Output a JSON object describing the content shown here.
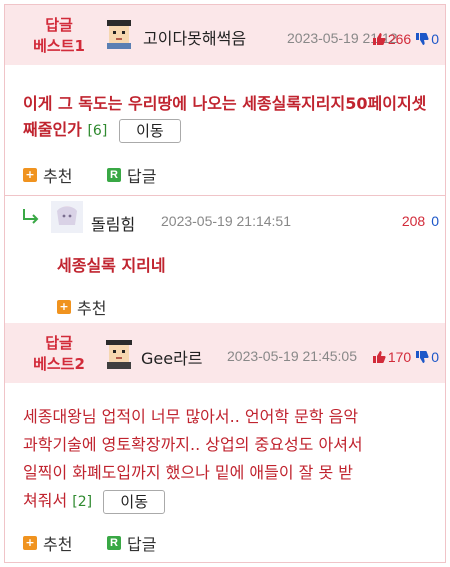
{
  "best1": {
    "tag": "답글\n베스트1",
    "tag_line1": "답글",
    "tag_line2": "베스트1",
    "nickname": "고이다못해썩음",
    "datetime": "2023-05-19 21:12",
    "upvotes": "266",
    "downvotes": "0",
    "content": "이게 그 독도는 우리땅에 나오는 세종실록지리지50페이지셋째줄인가",
    "reply_count": "[6]",
    "move_label": "이동",
    "recommend_label": "추천",
    "reply_label": "답글"
  },
  "nested_reply": {
    "nickname": "돌림힘",
    "datetime": "2023-05-19 21:14:51",
    "upvotes": "208",
    "downvotes": "0",
    "content": "세종실록 지리네",
    "recommend_label": "추천"
  },
  "best2": {
    "tag_line1": "답글",
    "tag_line2": "베스트2",
    "nickname": "Gee라르",
    "datetime": "2023-05-19 21:45:05",
    "upvotes": "170",
    "downvotes": "0",
    "content_line1": "세종대왕님 업적이 너무 많아서.. 언어학 문학 음악",
    "content_line2": "과학기술에 영토확장까지.. 상업의 중요성도 아셔서",
    "content_line3": "일찍이 화폐도입까지 했으나 밑에 애들이 잘 못 받",
    "content_line4": "쳐줘서",
    "reply_count": "[2]",
    "move_label": "이동",
    "recommend_label": "추천",
    "reply_label": "답글"
  },
  "colors": {
    "accent_red": "#d22b3a",
    "header_bg": "#fbe7e9",
    "count_green": "#2f8a2f",
    "down_blue": "#1d57c8"
  }
}
